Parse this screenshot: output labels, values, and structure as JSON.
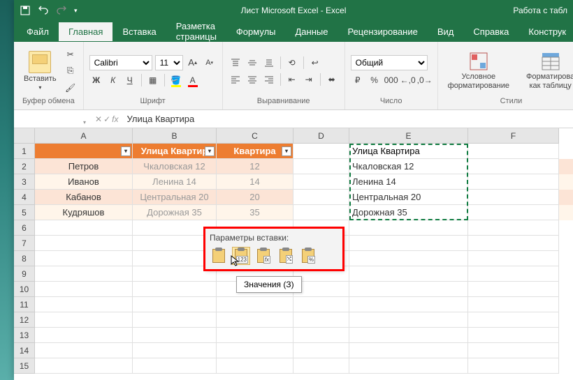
{
  "titlebar": {
    "title": "Лист Microsoft Excel  -  Excel",
    "right_hint": "Работа с табл"
  },
  "menu": {
    "file": "Файл",
    "home": "Главная",
    "insert": "Вставка",
    "layout": "Разметка страницы",
    "formulas": "Формулы",
    "data": "Данные",
    "review": "Рецензирование",
    "view": "Вид",
    "help": "Справка",
    "design": "Конструк"
  },
  "ribbon": {
    "clipboard": {
      "paste": "Вставить",
      "label": "Буфер обмена"
    },
    "font": {
      "name": "Calibri",
      "size": "11",
      "label": "Шрифт"
    },
    "alignment": {
      "label": "Выравнивание"
    },
    "number": {
      "format": "Общий",
      "label": "Число"
    },
    "styles": {
      "cond": "Условное форматирование",
      "table": "Форматирова как таблицу",
      "label": "Стили"
    }
  },
  "formula_bar": {
    "name_box": "",
    "fx": "fx",
    "value": "Улица Квартира"
  },
  "columns": [
    "A",
    "B",
    "C",
    "D",
    "E",
    "F"
  ],
  "headers": {
    "a": "",
    "b": "Улица Квартир",
    "c": "Квартира"
  },
  "rows": [
    {
      "a": "Петров",
      "b": "Чкаловская 12",
      "c": "12"
    },
    {
      "a": "Иванов",
      "b": "Ленина 14",
      "c": "14"
    },
    {
      "a": "Кабанов",
      "b": "Центральная 20",
      "c": "20"
    },
    {
      "a": "Кудряшов",
      "b": "Дорожная 35",
      "c": "35"
    }
  ],
  "col_e": [
    "Улица Квартира",
    "Чкаловская 12",
    "Ленина 14",
    "Центральная 20",
    "Дорожная 35"
  ],
  "paste_popup": {
    "title": "Параметры вставки:",
    "tooltip": "Значения (З)"
  }
}
